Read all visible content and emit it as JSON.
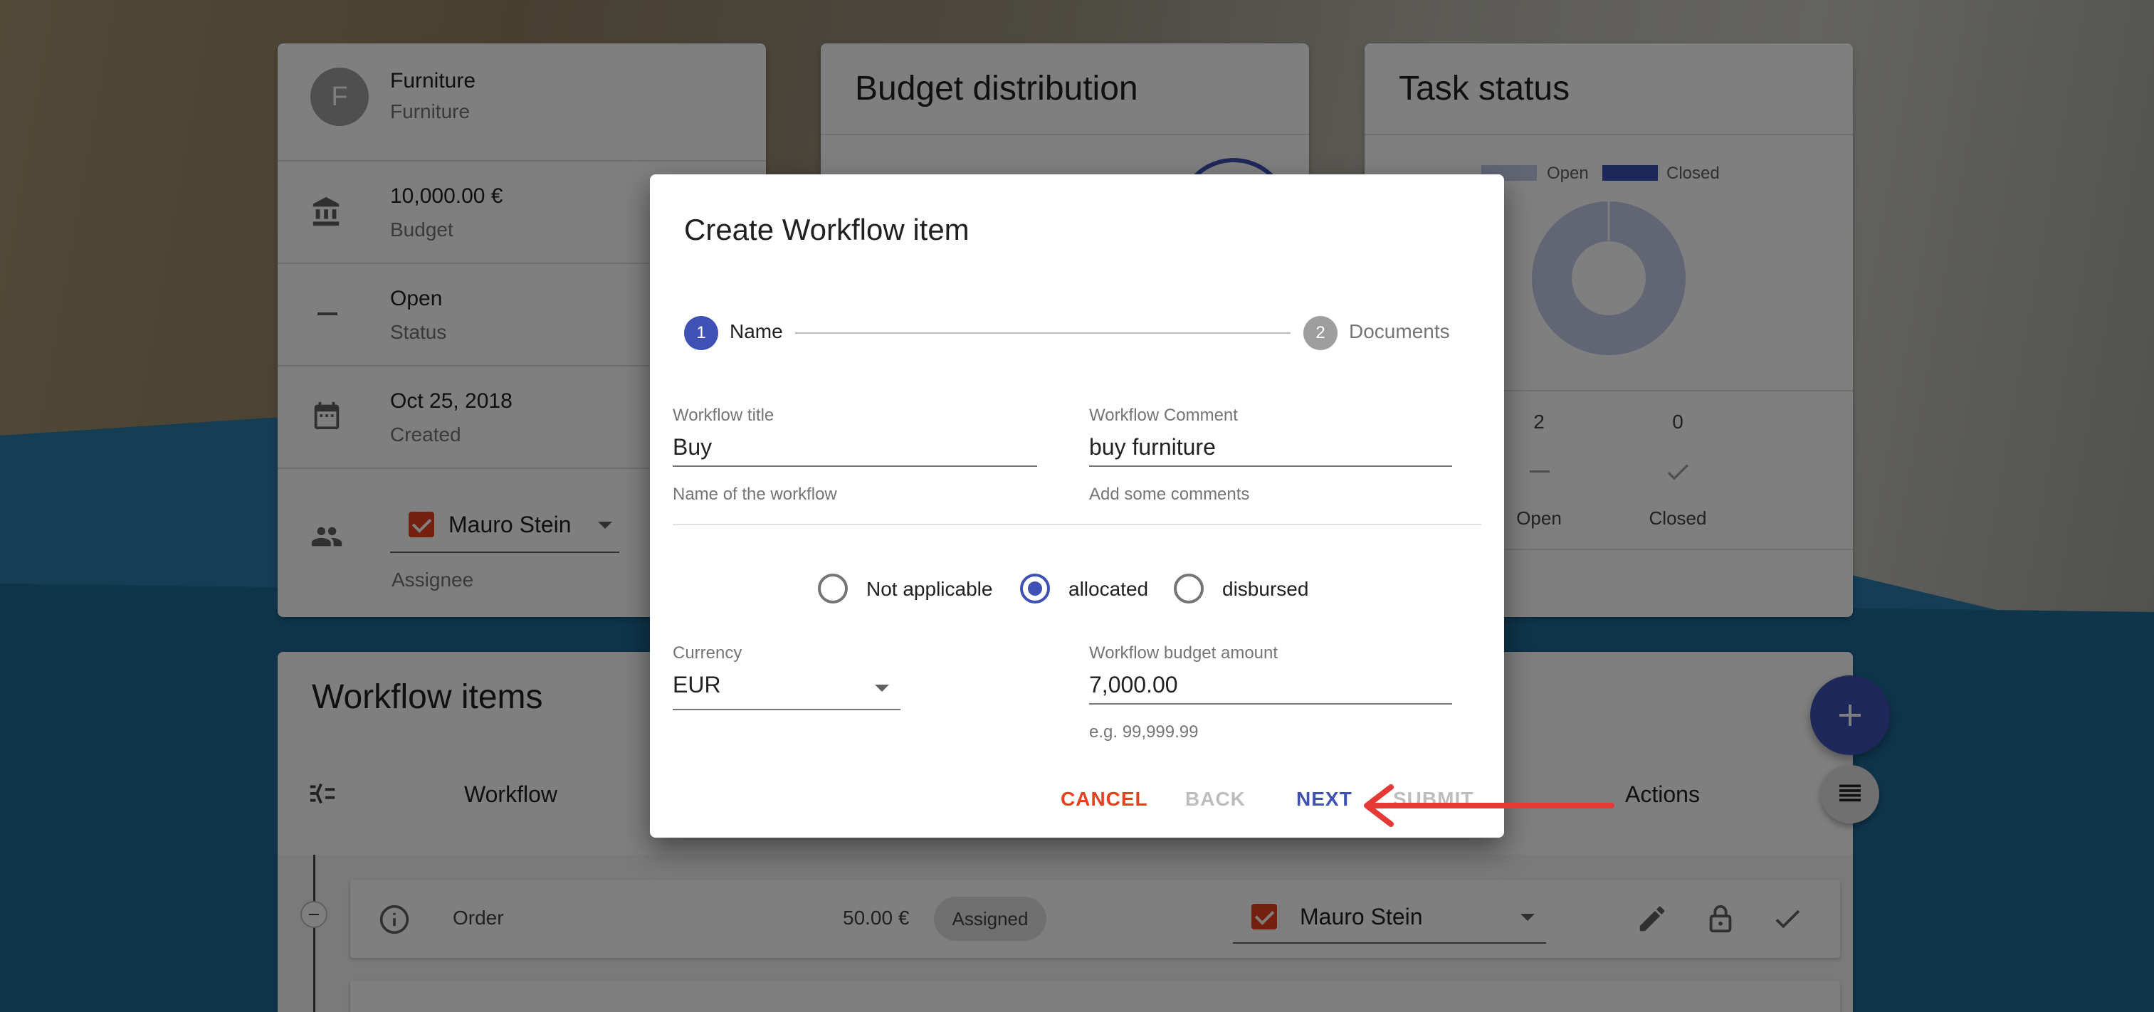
{
  "project": {
    "avatar_letter": "F",
    "name": "Furniture",
    "subtitle": "Furniture",
    "budget_value": "10,000.00 €",
    "budget_label": "Budget",
    "status_value": "Open",
    "status_label": "Status",
    "created_value": "Oct 25, 2018",
    "created_label": "Created",
    "assignee_value": "Mauro Stein",
    "assignee_label": "Assignee"
  },
  "budget_card": {
    "title": "Budget distribution"
  },
  "task_card": {
    "title": "Task status",
    "legend_open": "Open",
    "legend_closed": "Closed",
    "open_count": "2",
    "closed_count": "0",
    "open_label": "Open",
    "closed_label": "Closed"
  },
  "workflow": {
    "title": "Workflow items",
    "col_workflow": "Workflow",
    "col_actions": "Actions",
    "rows": [
      {
        "name": "Order",
        "amount": "50.00 €",
        "status": "Assigned",
        "assignee": "Mauro Stein"
      }
    ]
  },
  "dialog": {
    "title": "Create Workflow item",
    "steps": [
      {
        "number": "1",
        "label": "Name"
      },
      {
        "number": "2",
        "label": "Documents"
      }
    ],
    "workflow_title_label": "Workflow title",
    "workflow_title_value": "Buy",
    "workflow_title_helper": "Name of the workflow",
    "workflow_comment_label": "Workflow Comment",
    "workflow_comment_value": "buy furniture",
    "workflow_comment_helper": "Add some comments",
    "budget_types": [
      "Not applicable",
      "allocated",
      "disbursed"
    ],
    "selected_budget_type": "allocated",
    "currency_label": "Currency",
    "currency_value": "EUR",
    "amount_label": "Workflow budget amount",
    "amount_value": "7,000.00",
    "amount_helper": "e.g. 99,999.99",
    "buttons": {
      "cancel": "CANCEL",
      "back": "BACK",
      "next": "NEXT",
      "submit": "SUBMIT"
    }
  },
  "colors": {
    "primary": "#3f51b5",
    "accent": "#e8401c",
    "annotation_arrow": "#e53935",
    "chart_open": "#c5cae9",
    "chart_closed": "#3f51b5"
  }
}
